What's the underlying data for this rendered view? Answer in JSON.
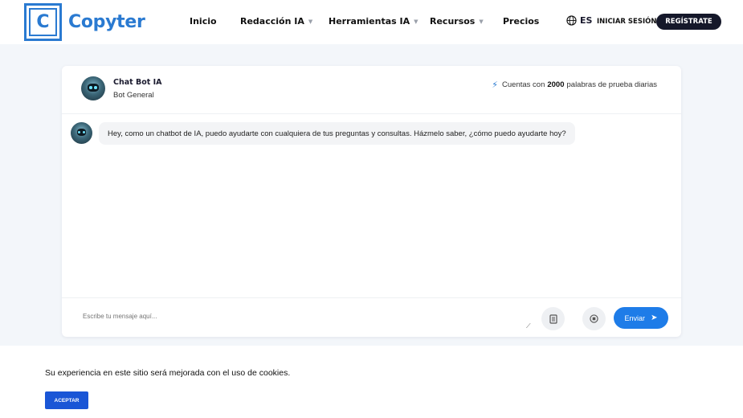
{
  "header": {
    "logo_letter": "C",
    "logo_text": "Copyter",
    "nav": [
      {
        "label": "Inicio",
        "dropdown": false
      },
      {
        "label": "Redacción IA",
        "dropdown": true
      },
      {
        "label": "Herramientas IA",
        "dropdown": true
      },
      {
        "label": "Recursos",
        "dropdown": true
      },
      {
        "label": "Precios",
        "dropdown": false
      }
    ],
    "language": "ES",
    "login_label": "INICIAR SESIÓN",
    "register_label": "REGÍSTRATE"
  },
  "chat": {
    "bot_name": "Chat Bot IA",
    "bot_role": "Bot General",
    "quota_prefix": "Cuentas con",
    "quota_count": "2000",
    "quota_suffix": "palabras de prueba diarias",
    "messages": [
      {
        "sender": "bot",
        "text": "Hey, como un chatbot de IA, puedo ayudarte con cualquiera de tus preguntas y consultas. Házmelo saber, ¿cómo puedo ayudarte hoy?"
      }
    ],
    "input_placeholder": "Escribe tu mensaje aquí...",
    "send_label": "Enviar"
  },
  "cookie_banner": {
    "text": "Su experiencia en este sitio será mejorada con el uso de cookies.",
    "accept_label": "ACEPTAR"
  },
  "colors": {
    "brand": "#2a7ad1",
    "send_button": "#1e7ce8",
    "register_button": "#15182a",
    "accept_button": "#1a56d6",
    "background": "#f3f6fa"
  },
  "icons": {
    "language": "globe-icon",
    "quota": "lightning-icon",
    "attach": "document-icon",
    "stop": "stop-icon",
    "send": "send-arrow-icon"
  }
}
